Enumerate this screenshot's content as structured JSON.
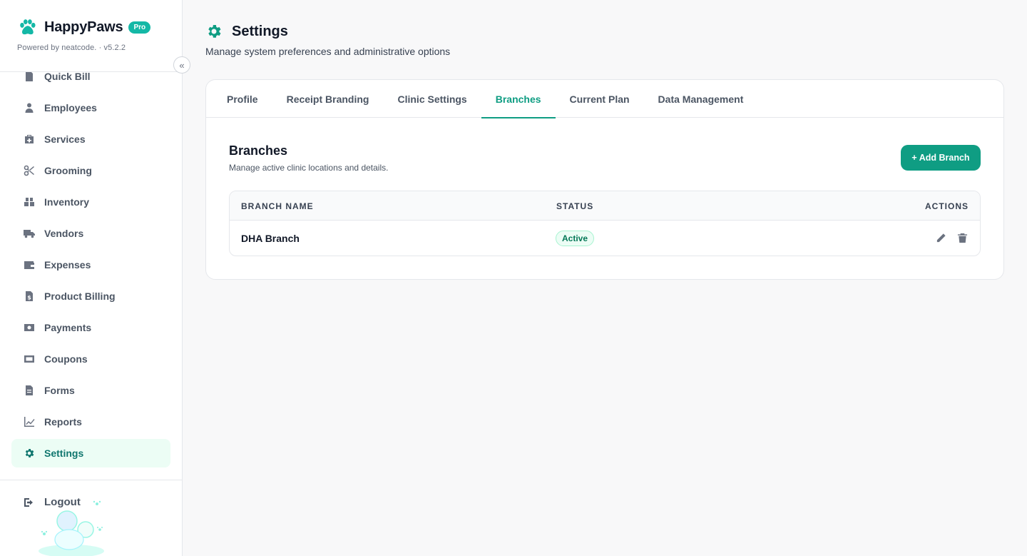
{
  "brand": {
    "name": "HappyPaws",
    "badge": "Pro",
    "powered_by": "Powered by neatcode. · v5.2.2",
    "accent_color": "#0f9d83"
  },
  "sidebar": {
    "items": [
      {
        "label": "Quick Bill",
        "icon": "document-icon"
      },
      {
        "label": "Employees",
        "icon": "person-icon"
      },
      {
        "label": "Services",
        "icon": "medical-bag-icon"
      },
      {
        "label": "Grooming",
        "icon": "scissors-icon"
      },
      {
        "label": "Inventory",
        "icon": "boxes-icon"
      },
      {
        "label": "Vendors",
        "icon": "truck-icon"
      },
      {
        "label": "Expenses",
        "icon": "wallet-icon"
      },
      {
        "label": "Product Billing",
        "icon": "invoice-dollar-icon"
      },
      {
        "label": "Payments",
        "icon": "cash-icon"
      },
      {
        "label": "Coupons",
        "icon": "ticket-icon"
      },
      {
        "label": "Forms",
        "icon": "form-icon"
      },
      {
        "label": "Reports",
        "icon": "chart-line-icon"
      },
      {
        "label": "Settings",
        "icon": "gear-icon",
        "active": true
      }
    ],
    "logout_label": "Logout"
  },
  "header": {
    "title": "Settings",
    "subtitle": "Manage system preferences and administrative options"
  },
  "tabs": [
    {
      "label": "Profile"
    },
    {
      "label": "Receipt Branding"
    },
    {
      "label": "Clinic Settings"
    },
    {
      "label": "Branches",
      "active": true
    },
    {
      "label": "Current Plan"
    },
    {
      "label": "Data Management"
    }
  ],
  "branches": {
    "title": "Branches",
    "subtitle": "Manage active clinic locations and details.",
    "add_button": "+ Add Branch",
    "columns": {
      "name": "BRANCH NAME",
      "status": "STATUS",
      "actions": "ACTIONS"
    },
    "rows": [
      {
        "name": "DHA Branch",
        "status": "Active"
      }
    ]
  }
}
